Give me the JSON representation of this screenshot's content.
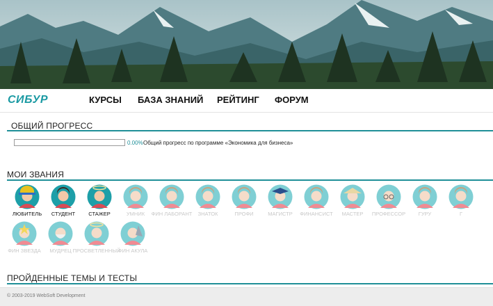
{
  "brand": {
    "logo_text": "СИБУР",
    "accent": "#1f8f98"
  },
  "nav": {
    "items": [
      {
        "label": "КУРСЫ"
      },
      {
        "label": "БАЗА ЗНАНИЙ"
      },
      {
        "label": "РЕЙТИНГ"
      },
      {
        "label": "ФОРУМ"
      }
    ]
  },
  "progress_section": {
    "title": "ОБЩИЙ ПРОГРЕСС",
    "percent_text": "0.00%",
    "value": 0,
    "description": "Общий прогресс по программе «Экономика для бизнеса»"
  },
  "ranks_section": {
    "title": "МОИ ЗВАНИЯ",
    "ranks": [
      {
        "label": "ЛЮБИТЕЛЬ",
        "earned": true,
        "icon": "beginner-avatar-icon"
      },
      {
        "label": "СТУДЕНТ",
        "earned": true,
        "icon": "student-avatar-icon"
      },
      {
        "label": "СТАЖЕР",
        "earned": true,
        "icon": "intern-avatar-icon"
      },
      {
        "label": "УМНИК",
        "earned": false,
        "icon": "smart-avatar-icon"
      },
      {
        "label": "ФИН ЛАБОРАНТ",
        "earned": false,
        "icon": "lab-assistant-avatar-icon"
      },
      {
        "label": "ЗНАТОК",
        "earned": false,
        "icon": "expert-avatar-icon"
      },
      {
        "label": "ПРОФИ",
        "earned": false,
        "icon": "pro-avatar-icon"
      },
      {
        "label": "МАГИСТР",
        "earned": false,
        "icon": "master-degree-avatar-icon"
      },
      {
        "label": "ФИНАНСИСТ",
        "earned": false,
        "icon": "financier-avatar-icon"
      },
      {
        "label": "МАСТЕР",
        "earned": false,
        "icon": "master-avatar-icon"
      },
      {
        "label": "ПРОФЕССОР",
        "earned": false,
        "icon": "professor-avatar-icon"
      },
      {
        "label": "ГУРУ",
        "earned": false,
        "icon": "guru-avatar-icon"
      },
      {
        "label": "Г",
        "earned": false,
        "icon": "next-rank-avatar-icon"
      },
      {
        "label": "ФИН ЗВЕЗДА",
        "earned": false,
        "icon": "star-avatar-icon"
      },
      {
        "label": "МУДРЕЦ",
        "earned": false,
        "icon": "sage-avatar-icon"
      },
      {
        "label": "ПРОСВЕТЛЕННЫЙ",
        "earned": false,
        "icon": "enlightened-avatar-icon"
      },
      {
        "label": "ФИН АКУЛА",
        "earned": false,
        "icon": "shark-avatar-icon"
      }
    ]
  },
  "completed_section": {
    "title": "ПРОЙДЕННЫЕ ТЕМЫ И ТЕСТЫ"
  },
  "footer": {
    "text": "© 2003-2019 WebSoft Development"
  }
}
